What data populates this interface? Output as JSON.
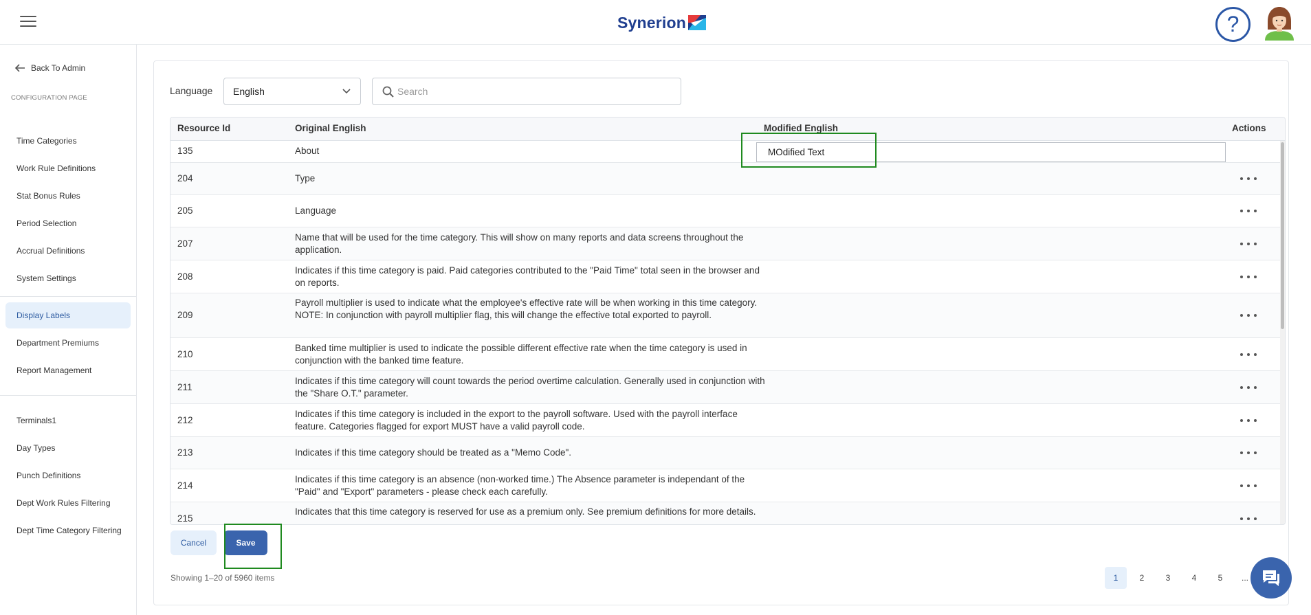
{
  "header": {
    "brand": "Synerion",
    "help_symbol": "?"
  },
  "sidebar": {
    "back_label": "Back To Admin",
    "section_title": "CONFIGURATION PAGE",
    "group1": [
      "Time Categories",
      "Work Rule Definitions",
      "Stat Bonus Rules",
      "Period Selection",
      "Accrual Definitions",
      "System Settings"
    ],
    "group2": [
      "Display Labels",
      "Department Premiums",
      "Report Management"
    ],
    "group3": [
      "Terminals1",
      "Day Types",
      "Punch Definitions",
      "Dept Work Rules Filtering",
      "Dept Time Category Filtering"
    ],
    "active_item": "Display Labels"
  },
  "filters": {
    "language_label": "Language",
    "language_value": "English",
    "search_placeholder": "Search"
  },
  "table": {
    "columns": [
      "Resource Id",
      "Original English",
      "Modified English",
      "Actions"
    ],
    "rows": [
      {
        "id": "135",
        "original": "About",
        "modified": "MOdified Text",
        "editing": true
      },
      {
        "id": "204",
        "original": "Type"
      },
      {
        "id": "205",
        "original": "Language"
      },
      {
        "id": "207",
        "original": "Name that will be used for the time category. This will show on many reports and data screens throughout the application."
      },
      {
        "id": "208",
        "original": "Indicates if this time category is paid. Paid categories contributed to the \"Paid Time\" total seen in the browser and on reports."
      },
      {
        "id": "209",
        "original": "Payroll multiplier is used to indicate what the employee's effective rate will be when working in this time category. NOTE: In conjunction with payroll multiplier flag, this will change the effective total exported to payroll."
      },
      {
        "id": "210",
        "original": "Banked time multiplier is used to indicate the possible different effective rate when the time category is used in conjunction with the banked time feature."
      },
      {
        "id": "211",
        "original": "Indicates if this time category will count towards the period overtime calculation. Generally used in conjunction with the \"Share O.T.\" parameter."
      },
      {
        "id": "212",
        "original": "Indicates if this time category is included in the export to the payroll software. Used with the payroll interface feature. Categories flagged for export MUST have a valid payroll code."
      },
      {
        "id": "213",
        "original": "Indicates if this time category should be treated as a \"Memo Code\"."
      },
      {
        "id": "214",
        "original": "Indicates if this time category is an absence (non-worked time.) The Absence parameter is independant of the \"Paid\" and \"Export\" parameters - please check each carefully."
      },
      {
        "id": "215",
        "original": "Indicates that this time category is reserved for use as a premium only. See premium definitions for more details."
      }
    ]
  },
  "actions": {
    "cancel_label": "Cancel",
    "save_label": "Save"
  },
  "footer": {
    "showing_text": "Showing 1–20 of 5960 items",
    "pages": [
      "1",
      "2",
      "3",
      "4",
      "5",
      "..."
    ],
    "current_page": "1"
  },
  "icons": {
    "menu": "hamburger-icon",
    "help": "help-icon",
    "user": "avatar",
    "back": "arrow-left-icon",
    "dropdown": "chevron-down-icon",
    "search": "search-icon",
    "row_actions": "more-horizontal-icon",
    "chat": "chat-icon"
  },
  "colors": {
    "brand": "#1f3e8f",
    "accent": "#3a64ad",
    "active_bg": "#e6f0fb",
    "highlight": "#1f8a1f"
  }
}
